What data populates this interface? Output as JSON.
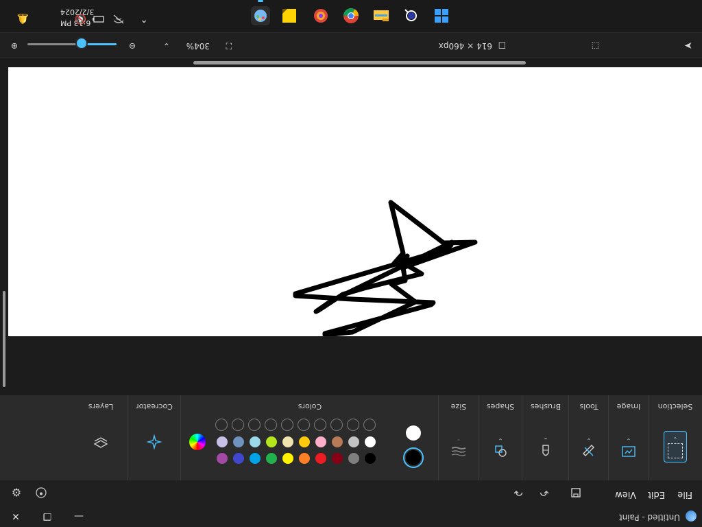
{
  "window": {
    "title": "Untitled - Paint"
  },
  "menu": {
    "file": "File",
    "edit": "Edit",
    "view": "View"
  },
  "ribbon": {
    "groups": [
      {
        "label": "Selection"
      },
      {
        "label": "Image"
      },
      {
        "label": "Tools"
      },
      {
        "label": "Brushes"
      },
      {
        "label": "Shapes"
      },
      {
        "label": "Size"
      },
      {
        "label": "Colors"
      },
      {
        "label": "Cocreator"
      },
      {
        "label": "Layers"
      }
    ],
    "colors": {
      "primary": "#000000",
      "secondary": "#ffffff",
      "palette_row1": [
        "#000000",
        "#7f7f7f",
        "#880015",
        "#ed1c24",
        "#ff7f27",
        "#fff200",
        "#22b14c",
        "#00a2e8",
        "#3f48cc",
        "#a349a4"
      ],
      "palette_row2": [
        "#ffffff",
        "#c3c3c3",
        "#b97a57",
        "#ffaec9",
        "#ffc90e",
        "#efe4b0",
        "#b5e61d",
        "#99d9ea",
        "#7092be",
        "#c8bfe7"
      ]
    }
  },
  "status": {
    "canvas_size": "614 × 460px",
    "zoom_percent": "304%",
    "zoom_level": 0.38
  },
  "taskbar": {
    "time": "6:13 PM",
    "date": "3/2/2024"
  }
}
